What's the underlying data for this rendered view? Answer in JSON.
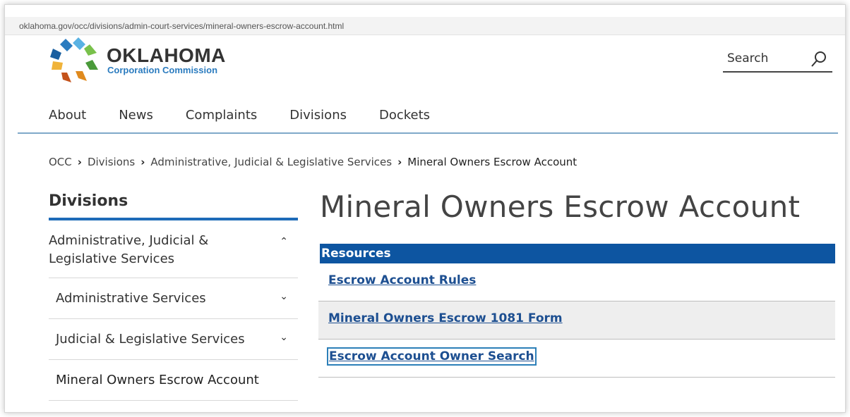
{
  "browser": {
    "url": "oklahoma.gov/occ/divisions/admin-court-services/mineral-owners-escrow-account.html"
  },
  "brand": {
    "name": "OKLAHOMA",
    "subtitle": "Corporation Commission"
  },
  "search": {
    "label": "Search",
    "icon": "search-icon"
  },
  "nav": {
    "items": [
      "About",
      "News",
      "Complaints",
      "Divisions",
      "Dockets"
    ]
  },
  "breadcrumb": {
    "items": [
      "OCC",
      "Divisions",
      "Administrative, Judicial & Legislative Services"
    ],
    "current": "Mineral Owners Escrow Account"
  },
  "sidebar": {
    "title": "Divisions",
    "items": [
      {
        "label": "Administrative, Judicial & Legislative Services",
        "icon": "chevron-up-icon"
      },
      {
        "label": "Administrative Services",
        "icon": "chevron-down-icon"
      },
      {
        "label": "Judicial & Legislative Services",
        "icon": "chevron-down-icon"
      },
      {
        "label": "Mineral Owners Escrow Account"
      }
    ]
  },
  "main": {
    "title": "Mineral Owners Escrow Account",
    "resources_header": "Resources",
    "links": [
      "Escrow Account Rules",
      "Mineral Owners Escrow 1081 Form",
      "Escrow Account Owner Search"
    ]
  },
  "colors": {
    "accent": "#0d55a1",
    "link": "#1d4f91",
    "sidebar_bar": "#1e6bb8"
  }
}
